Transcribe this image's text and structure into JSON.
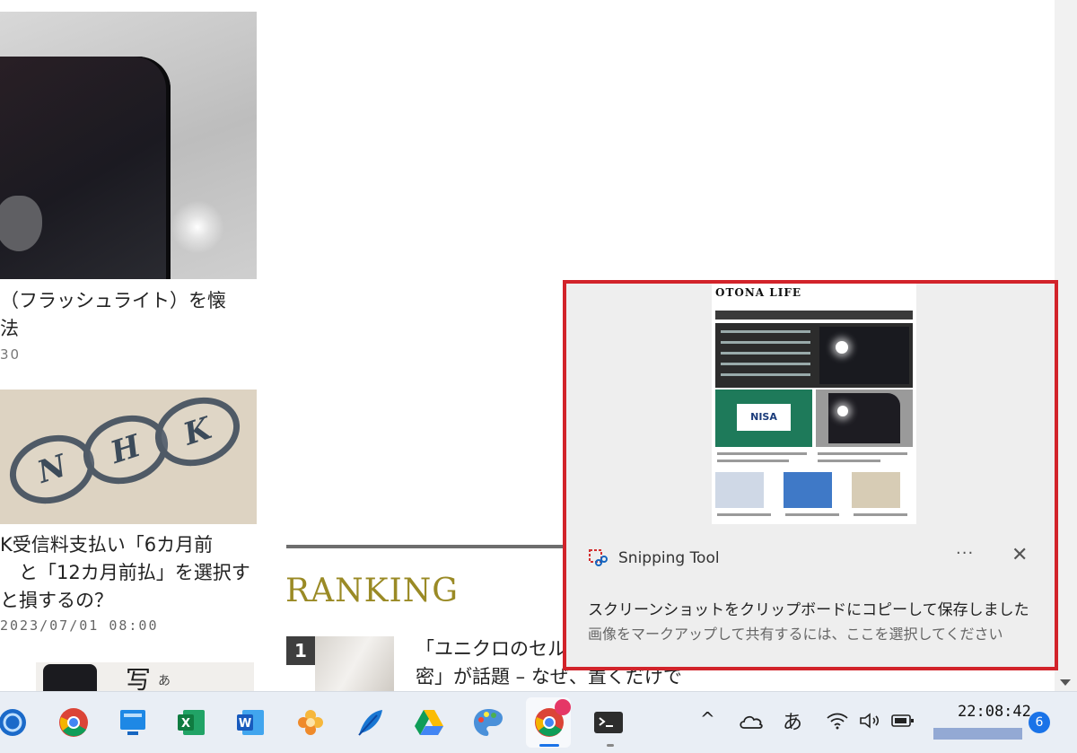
{
  "articles": [
    {
      "title": "（フラッシュライト）を懐\n法",
      "date": "30"
    },
    {
      "title": "K受信料支払い「6カ月前\n　と「12カ月前払」を選択す\nと損するの？",
      "date": "2023/07/01 08:00"
    }
  ],
  "thumb3": {
    "kanji": "写",
    "kana": "あ"
  },
  "ranking": {
    "heading": "RANKING",
    "items": [
      {
        "rank": "1",
        "title": "「ユニクロのセル\n密」が話題 – なぜ、置くだけで"
      }
    ]
  },
  "notification": {
    "app_name": "Snipping Tool",
    "more": "···",
    "close": "✕",
    "title": "スクリーンショットをクリップボードにコピーして保存しました",
    "subtitle": "画像をマークアップして共有するには、ここを選択してください",
    "preview": {
      "logo": "OTONA LIFE",
      "nisa": "NISA"
    }
  },
  "taskbar": {
    "apps": [
      {
        "name": "network-app",
        "color": "#1b6ac9"
      },
      {
        "name": "chrome",
        "color": "#db4437"
      },
      {
        "name": "desktop-app",
        "color": "#1e88e5"
      },
      {
        "name": "excel",
        "color": "#1d6f42"
      },
      {
        "name": "word",
        "color": "#2b579a"
      },
      {
        "name": "photos-app",
        "color": "#f0a030"
      },
      {
        "name": "feather-app",
        "color": "#1976d2"
      },
      {
        "name": "google-drive",
        "color": "#34a853"
      },
      {
        "name": "paint",
        "color": "#4a90d9"
      },
      {
        "name": "chrome-profile",
        "color": "#db4437"
      },
      {
        "name": "terminal",
        "color": "#2d2d2d"
      }
    ],
    "tray": {
      "chevron": "^",
      "ime": "あ"
    },
    "clock": "22:08:42",
    "notification_count": "6"
  }
}
